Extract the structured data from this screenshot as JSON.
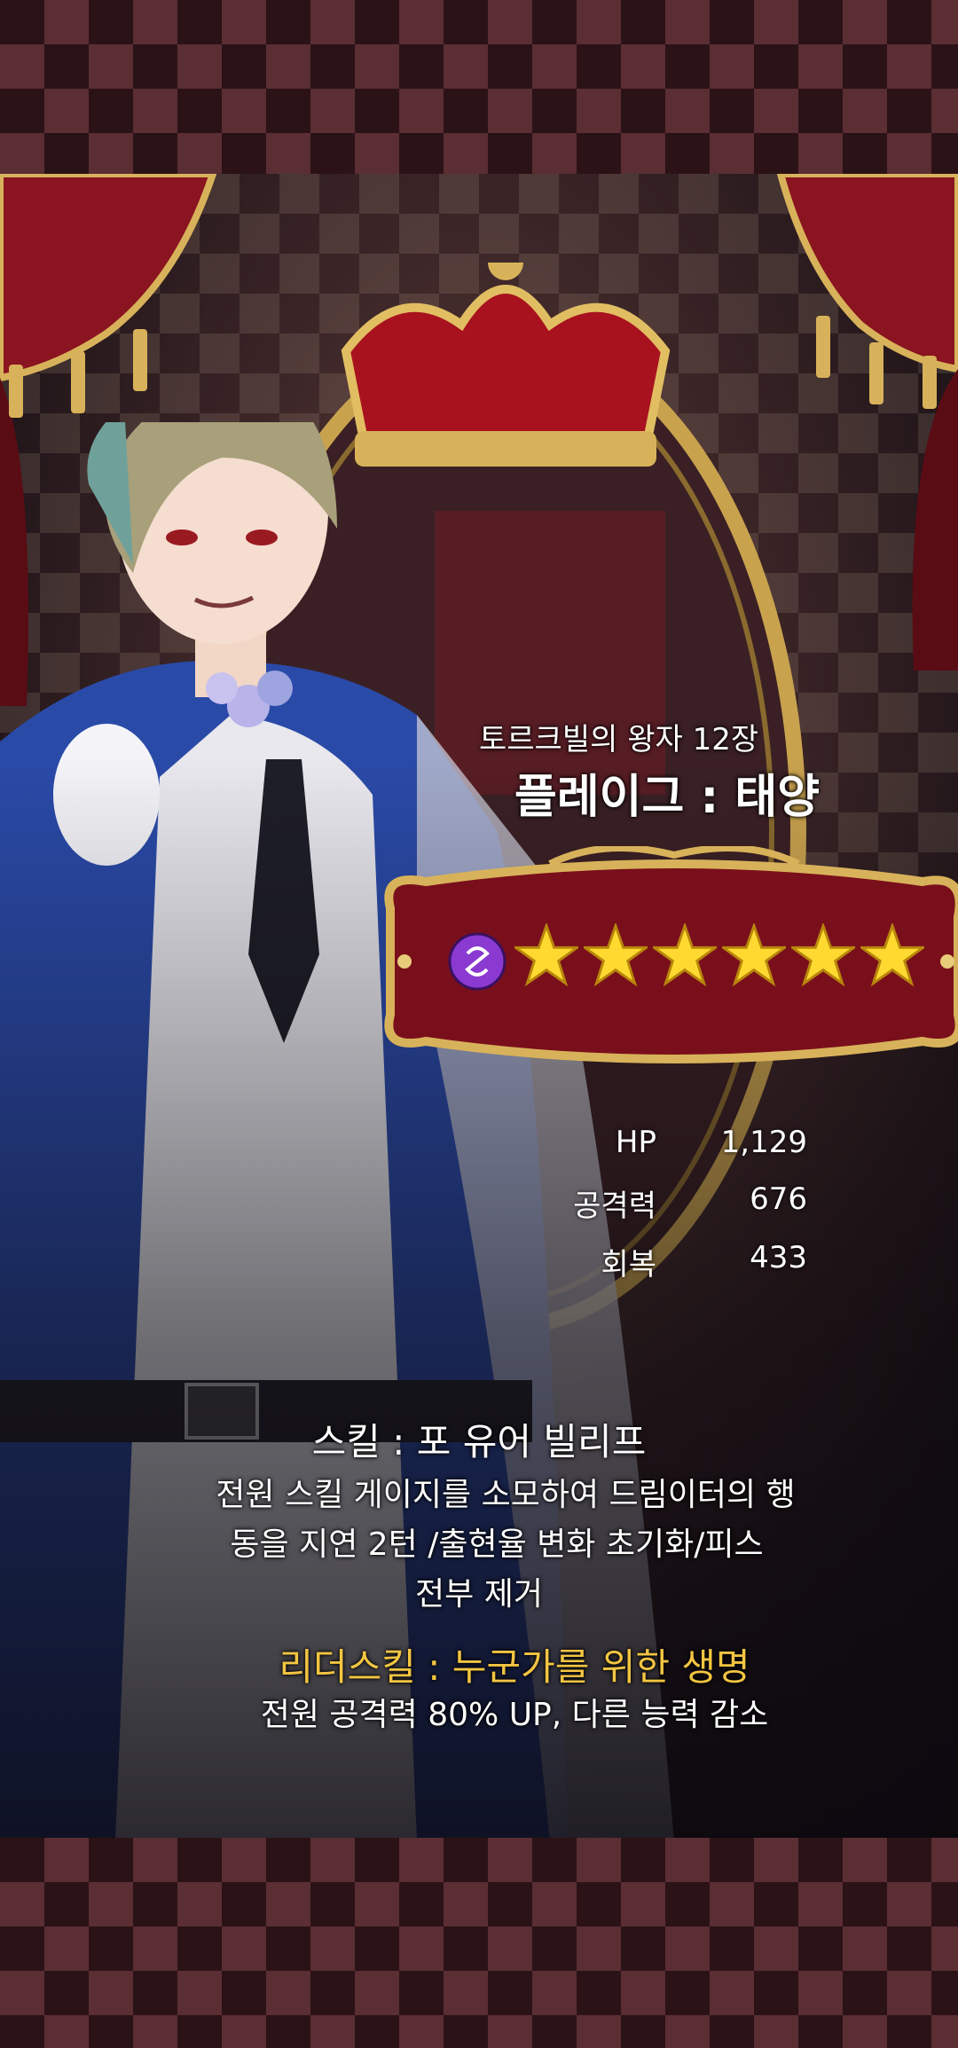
{
  "card": {
    "chapter_title": "토르크빌의 왕자 12장",
    "name": "플레이그 : 태양",
    "rarity_stars": 6,
    "attribute_icon": "purple-swirl-orb-icon"
  },
  "stats": [
    {
      "label": "HP",
      "value": "1,129"
    },
    {
      "label": "공격력",
      "value": "676"
    },
    {
      "label": "회복",
      "value": "433"
    }
  ],
  "skill": {
    "title": "스킬 : 포 유어 빌리프",
    "desc_line1": "전원 스킬 게이지를 소모하여 드림이터의 행",
    "desc_line2": "동을 지연 2턴 /출현율 변화 초기화/피스",
    "desc_line3": "전부 제거"
  },
  "leader_skill": {
    "title": "리더스킬 : 누군가를 위한 생명",
    "desc": "전원 공격력 80% UP, 다른 능력 감소"
  },
  "colors": {
    "background_checker_dark": "#2b1216",
    "background_checker_light": "#5a2e33",
    "leader_skill_title": "#f3c542",
    "rarity_panel_red": "#7a0f1c",
    "gold_frame": "#d8b25a"
  }
}
